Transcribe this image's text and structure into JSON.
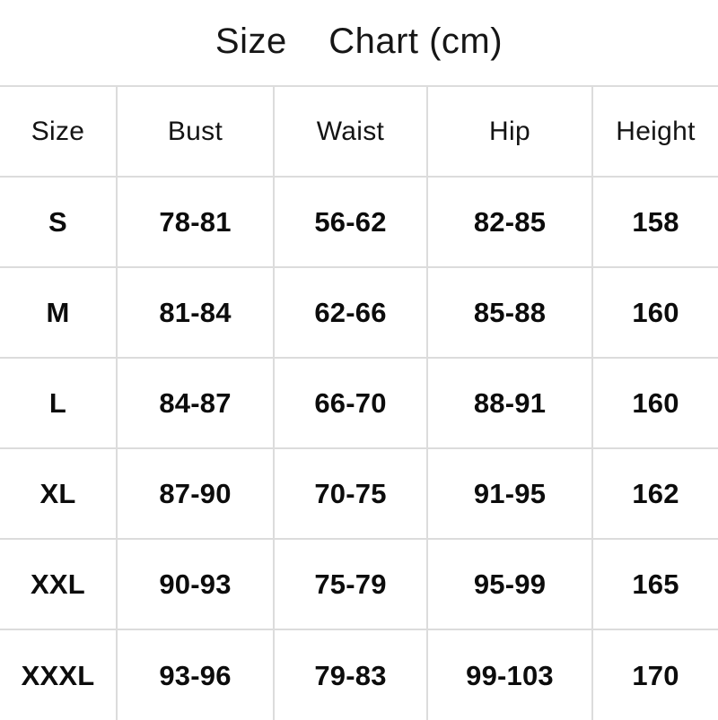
{
  "title": "Size    Chart (cm)",
  "chart_data": {
    "type": "table",
    "title": "Size    Chart (cm)",
    "unit": "cm",
    "columns": [
      "Size",
      "Bust",
      "Waist",
      "Hip",
      "Height"
    ],
    "rows": [
      {
        "size": "S",
        "bust": "78-81",
        "waist": "56-62",
        "hip": "82-85",
        "height": "158"
      },
      {
        "size": "M",
        "bust": "81-84",
        "waist": "62-66",
        "hip": "85-88",
        "height": "160"
      },
      {
        "size": "L",
        "bust": "84-87",
        "waist": "66-70",
        "hip": "88-91",
        "height": "160"
      },
      {
        "size": "XL",
        "bust": "87-90",
        "waist": "70-75",
        "hip": "91-95",
        "height": "162"
      },
      {
        "size": "XXL",
        "bust": "90-93",
        "waist": "75-79",
        "hip": "95-99",
        "height": "165"
      },
      {
        "size": "XXXL",
        "bust": "93-96",
        "waist": "79-83",
        "hip": "99-103",
        "height": "170"
      }
    ],
    "colors": {
      "background": "#ffffff",
      "text": "#0c0c0c",
      "gridline": "#dcdcdc"
    }
  },
  "table": {
    "headers": {
      "size": "Size",
      "bust": "Bust",
      "waist": "Waist",
      "hip": "Hip",
      "height": "Height"
    },
    "rows": [
      {
        "size": "S",
        "bust": "78-81",
        "waist": "56-62",
        "hip": "82-85",
        "height": "158"
      },
      {
        "size": "M",
        "bust": "81-84",
        "waist": "62-66",
        "hip": "85-88",
        "height": "160"
      },
      {
        "size": "L",
        "bust": "84-87",
        "waist": "66-70",
        "hip": "88-91",
        "height": "160"
      },
      {
        "size": "XL",
        "bust": "87-90",
        "waist": "70-75",
        "hip": "91-95",
        "height": "162"
      },
      {
        "size": "XXL",
        "bust": "90-93",
        "waist": "75-79",
        "hip": "95-99",
        "height": "165"
      },
      {
        "size": "XXXL",
        "bust": "93-96",
        "waist": "79-83",
        "hip": "99-103",
        "height": "170"
      }
    ]
  }
}
